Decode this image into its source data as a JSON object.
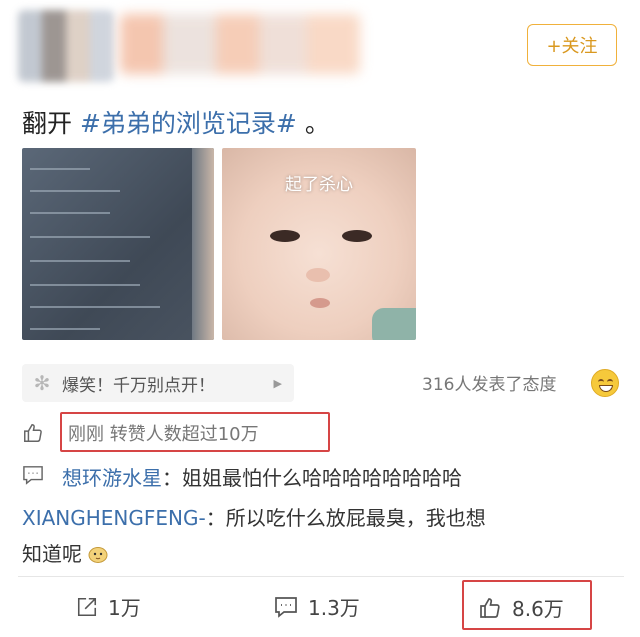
{
  "header": {
    "follow_label": "+关注"
  },
  "post": {
    "text_prefix": "翻开",
    "hashtag": "#弟弟的浏览记录#",
    "text_suffix": "。",
    "image_caption": "起了杀心"
  },
  "promo": {
    "label": "爆笑！千万别点开！",
    "attitude_text": "316人发表了态度"
  },
  "repost_notice": "刚刚 转赞人数超过10万",
  "comments": [
    {
      "user": "想环游水星",
      "text": "：姐姐最怕什么哈哈哈哈哈哈哈哈"
    },
    {
      "user": "XIANGHENGFENG-",
      "text": "：所以吃什么放屁最臭，我也想",
      "text_cont": "知道呢"
    }
  ],
  "actions": {
    "share_count": "1万",
    "comment_count": "1.3万",
    "like_count": "8.6万"
  },
  "colors": {
    "accent_orange": "#f0b13b",
    "link_blue": "#3c6fab",
    "highlight_red": "#d64545"
  },
  "icons": [
    "sparkle-icon",
    "arrow-right-icon",
    "grin-emoji-icon",
    "thumbs-up-icon",
    "comment-icon",
    "share-icon",
    "doge-emoji-icon"
  ]
}
